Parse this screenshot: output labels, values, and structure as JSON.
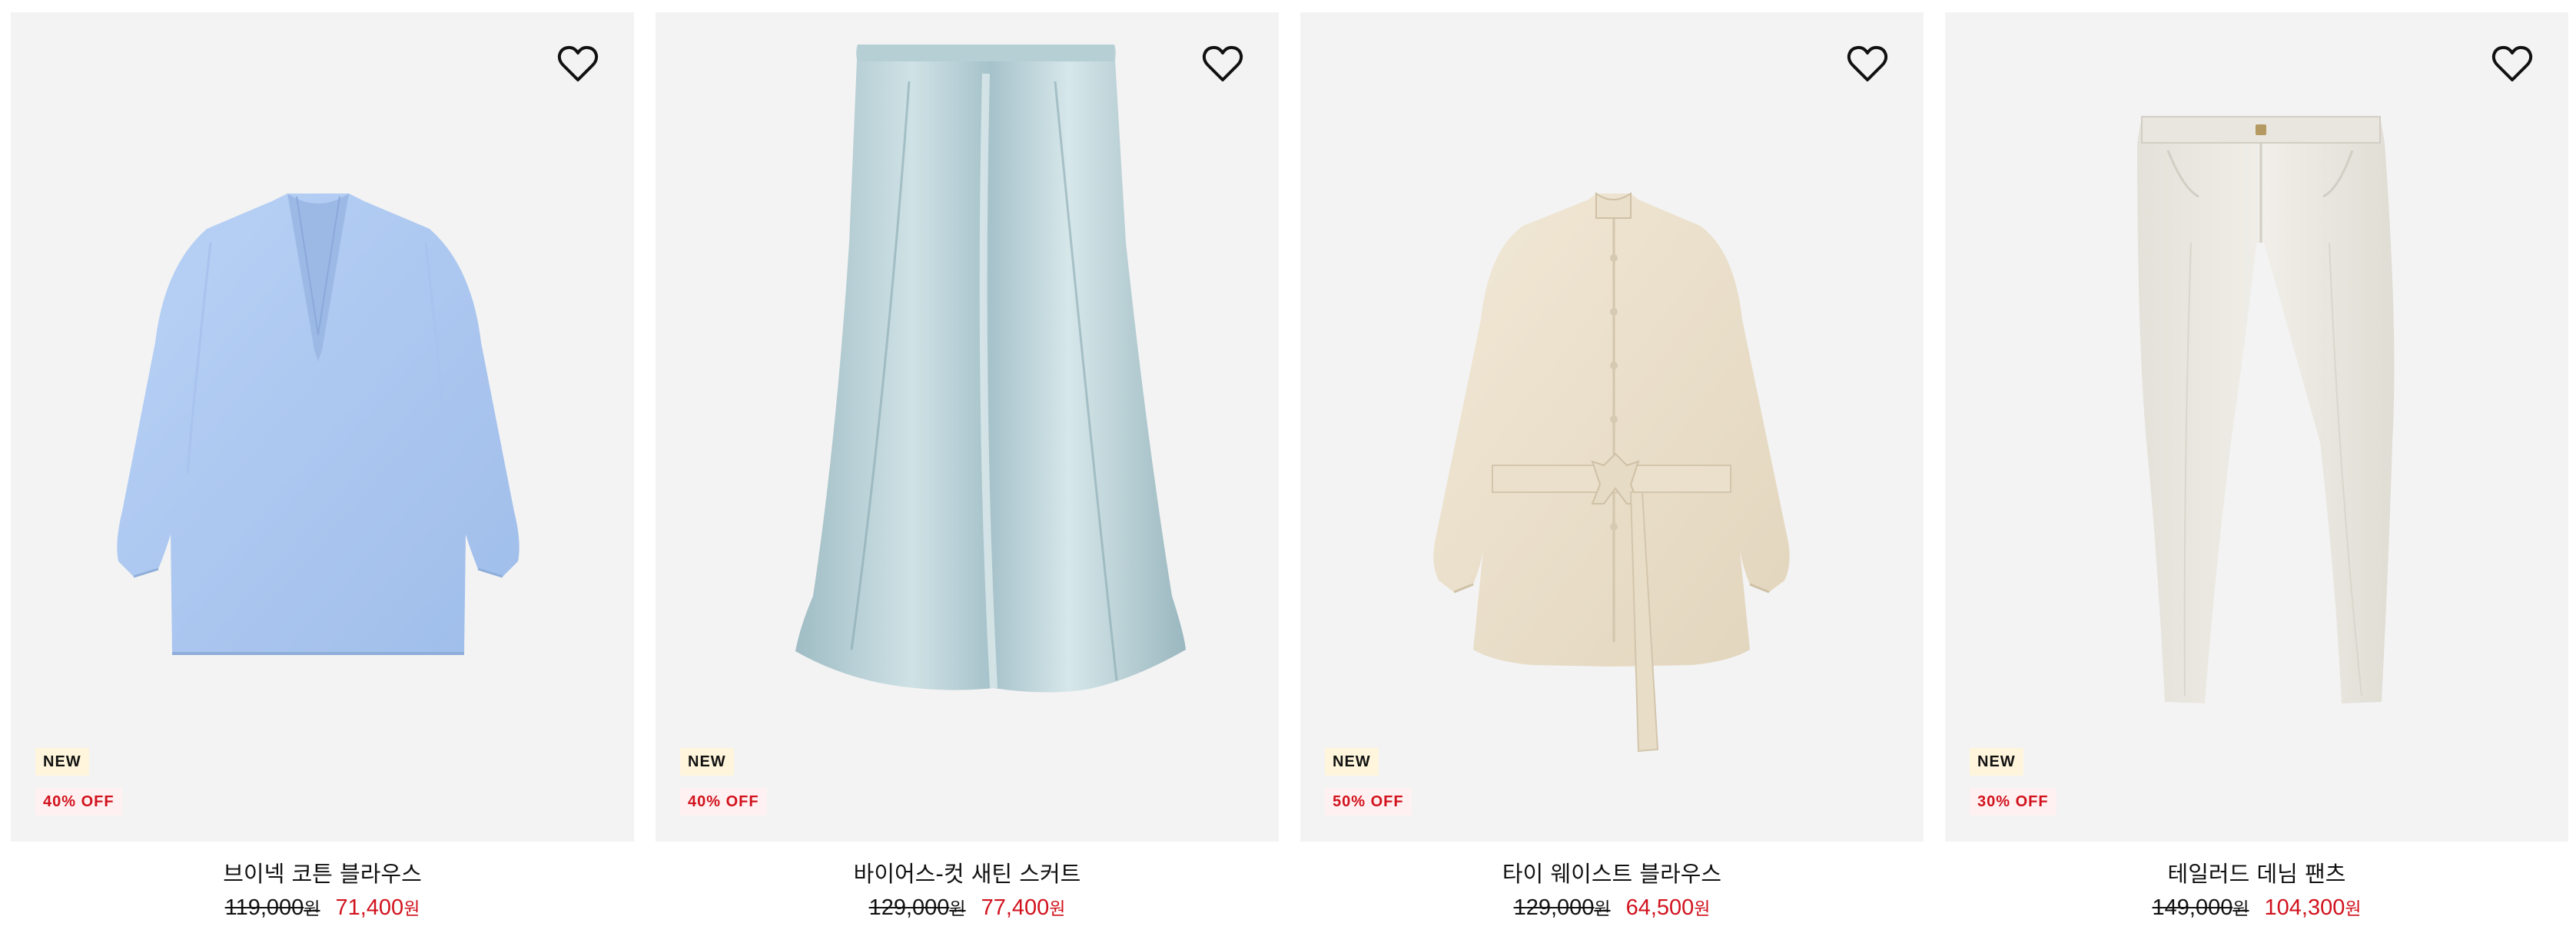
{
  "colors": {
    "card_bg": "#f3f3f3",
    "sale_red": "#d1121d",
    "new_badge_bg": "#fff5dd",
    "off_badge_bg": "#fff1f1",
    "text": "#111111"
  },
  "products": [
    {
      "name": "브이넥 코튼 블라우스",
      "badge_new": "NEW",
      "badge_discount": "40% OFF",
      "price_original": "119,000",
      "price_sale": "71,400",
      "currency": "원",
      "image": "light-blue-vneck-blouse",
      "wishlist_icon": "heart-outline-icon"
    },
    {
      "name": "바이어스-컷 새틴 스커트",
      "badge_new": "NEW",
      "badge_discount": "40% OFF",
      "price_original": "129,000",
      "price_sale": "77,400",
      "currency": "원",
      "image": "pale-blue-satin-skirt",
      "wishlist_icon": "heart-outline-icon"
    },
    {
      "name": "타이 웨이스트 블라우스",
      "badge_new": "NEW",
      "badge_discount": "50% OFF",
      "price_original": "129,000",
      "price_sale": "64,500",
      "currency": "원",
      "image": "cream-tie-waist-blouse",
      "wishlist_icon": "heart-outline-icon"
    },
    {
      "name": "테일러드 데님 팬츠",
      "badge_new": "NEW",
      "badge_discount": "30% OFF",
      "price_original": "149,000",
      "price_sale": "104,300",
      "currency": "원",
      "image": "off-white-denim-pants",
      "wishlist_icon": "heart-outline-icon"
    }
  ]
}
